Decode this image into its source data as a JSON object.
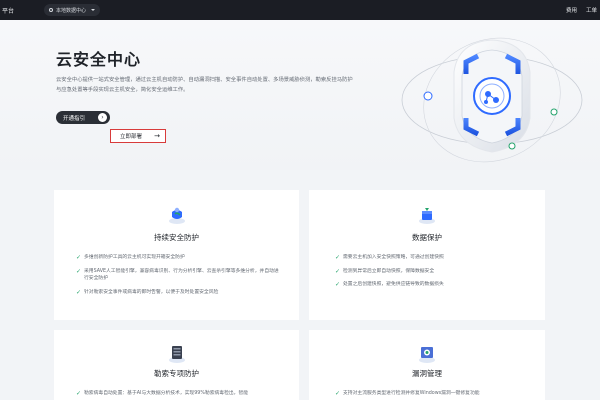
{
  "topbar": {
    "brand": "平台",
    "region": "本地数据中心",
    "links": {
      "fee": "费用",
      "ticket": "工单"
    }
  },
  "hero": {
    "title": "云安全中心",
    "description": "云安全中心提供一站式安全管理，通过云主机自动防护、自动漏洞扫描、安全事件自动处置、多场景威胁侦测，勒索反挂马防护与应急处置等手段实现云主机安全，简化安全运维工作。",
    "guide_button": "开通指引",
    "deploy_button": "立即部署"
  },
  "cards": [
    {
      "title": "持续安全防护",
      "icon": "shield-cloud-icon",
      "items": [
        "多维创新防护工具的云主机可实现开箱安全防护",
        "采用SAVE人工智能引擎，兼容病毒识别、行为分析引擎、云查杀引擎等多维分析，并自动进行安全防护",
        "针对勒索安全事件或病毒的即时告警，以便于及时处置安全风险"
      ]
    },
    {
      "title": "数据保护",
      "icon": "database-icon",
      "items": [
        "需要云主机加入安全快照策略，可通过创建快照",
        "检测到异常后立即自动快照，保障数据安全",
        "处置之后创建快照，避免供应链导致的数据损失"
      ]
    },
    {
      "title": "勒索专项防护",
      "icon": "server-icon",
      "items": [
        "勒索病毒自动处置：基于AI与大数据分析技术，实现99%勒索病毒检出，智能"
      ]
    },
    {
      "title": "漏洞管理",
      "icon": "bug-scan-icon",
      "items": [
        "支持对主流服务类型进行检测并修复Windows漏洞一键修复功能"
      ]
    }
  ],
  "colors": {
    "topbar": "#1b1d24",
    "accent_blue": "#2f6bff",
    "check_green": "#23a36b",
    "highlight_red": "#d83b3b"
  }
}
